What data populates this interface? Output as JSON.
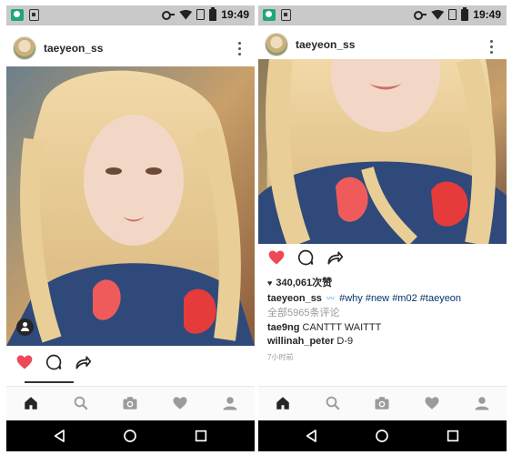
{
  "status_bar": {
    "time": "19:49"
  },
  "left_post": {
    "username": "taeyeon_ss"
  },
  "right_post": {
    "username": "taeyeon_ss",
    "likes": "340,061次赞",
    "caption_user": "taeyeon_ss",
    "caption_tags": [
      "#why",
      "#new",
      "#m02",
      "#taeyeon"
    ],
    "view_all_comments": "全部5965条评论",
    "comments": [
      {
        "user": "tae9ng",
        "text": "CANTTT WAITTT"
      },
      {
        "user": "willinah_peter",
        "text": "D-9"
      }
    ],
    "time_ago": "7小时前"
  },
  "icons": {
    "like": "heart-icon-filled",
    "comment": "comment-icon",
    "share": "share-icon",
    "nav": [
      "home-icon",
      "search-icon",
      "camera-icon",
      "activity-heart-icon",
      "profile-icon"
    ],
    "android": [
      "back-icon",
      "home-circle-icon",
      "recents-icon"
    ]
  },
  "colors": {
    "like": "#ed4956",
    "tag": "#003569",
    "muted": "#999999"
  }
}
